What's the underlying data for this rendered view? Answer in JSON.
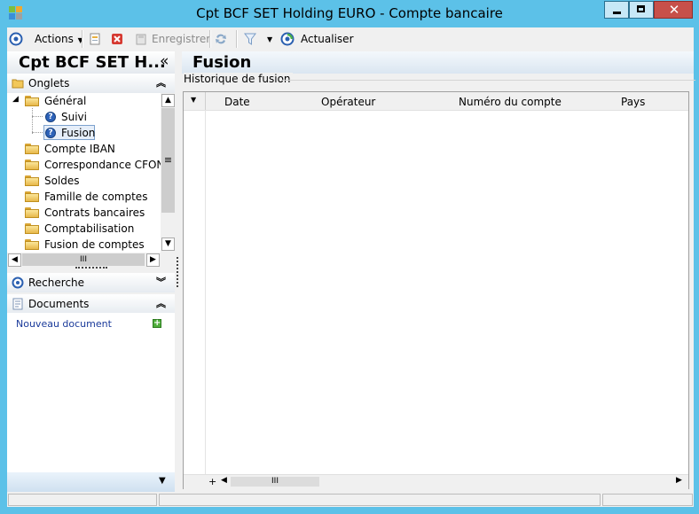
{
  "window": {
    "title": "Cpt BCF SET Holding EURO -  Compte bancaire",
    "close_glyph": "✕"
  },
  "toolbar": {
    "actions_label": "Actions",
    "save_label": "Enregistrer",
    "refresh_label": "Actualiser"
  },
  "left": {
    "title": "Cpt BCF SET H...",
    "collapse_glyph": "«",
    "tabs_header": "Onglets",
    "search_header": "Recherche",
    "documents_header": "Documents",
    "new_document": "Nouveau document",
    "tree": {
      "general": "Général",
      "suivi": "Suivi",
      "fusion": "Fusion",
      "items": [
        "Compte IBAN",
        "Correspondance CFONB",
        "Soldes",
        "Famille de comptes",
        "Contrats bancaires",
        "Comptabilisation",
        "Fusion de comptes"
      ]
    },
    "scroll_thumb": "≡",
    "hscroll_thumb": "III"
  },
  "right": {
    "title": "Fusion",
    "group_label": "Historique de fusion",
    "columns": [
      "Date",
      "Opérateur",
      "Numéro du compte",
      "Pays"
    ],
    "add_row_glyph": "+",
    "hscroll_thumb": "III"
  },
  "colors": {
    "window_frame": "#5cc1e8",
    "close_button": "#c7504a",
    "link": "#1a3a9a"
  }
}
